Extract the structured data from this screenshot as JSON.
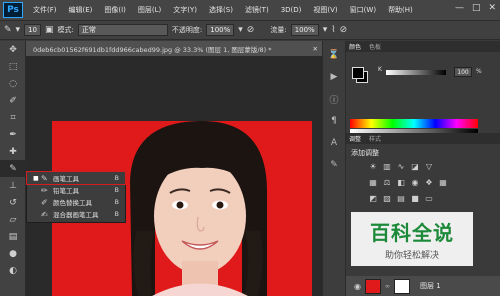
{
  "app": {
    "logo": "Ps"
  },
  "menu": [
    "文件(F)",
    "编辑(E)",
    "图像(I)",
    "图层(L)",
    "文字(Y)",
    "选择(S)",
    "滤镜(T)",
    "3D(D)",
    "视图(V)",
    "窗口(W)",
    "帮助(H)"
  ],
  "window_controls": {
    "minimize": "—",
    "maximize": "□",
    "close": "✕"
  },
  "options": {
    "brush_size": "10",
    "mode_label": "模式:",
    "mode_value": "正常",
    "opacity_label": "不透明度:",
    "opacity_value": "100%",
    "flow_label": "流量:",
    "flow_value": "100%"
  },
  "document": {
    "tab_title": "0deb6cb01562f691db1fdd966cabed99.jpg @ 33.3% (图层 1, 图层蒙版/8) *"
  },
  "flyout": [
    {
      "label": "画笔工具",
      "shortcut": "B",
      "selected": true,
      "icon": "brush-icon"
    },
    {
      "label": "铅笔工具",
      "shortcut": "B",
      "selected": false,
      "icon": "pencil-icon"
    },
    {
      "label": "颜色替换工具",
      "shortcut": "B",
      "selected": false,
      "icon": "color-replace-icon"
    },
    {
      "label": "混合器画笔工具",
      "shortcut": "B",
      "selected": false,
      "icon": "mixer-brush-icon"
    }
  ],
  "panels": {
    "color_tabs": [
      "颜色",
      "色板"
    ],
    "k_label": "K",
    "k_value": "100",
    "k_unit": "%",
    "adj_tabs": [
      "调整",
      "样式"
    ],
    "adj_title": "添加调整",
    "layer_name": "图层 1"
  },
  "watermark": {
    "main": "百科全说",
    "sub": "助你轻松解决"
  },
  "colors": {
    "canvas_bg": "#e01a1a",
    "ps_blue": "#31a8ff",
    "watermark_green": "#1d8a3a"
  }
}
